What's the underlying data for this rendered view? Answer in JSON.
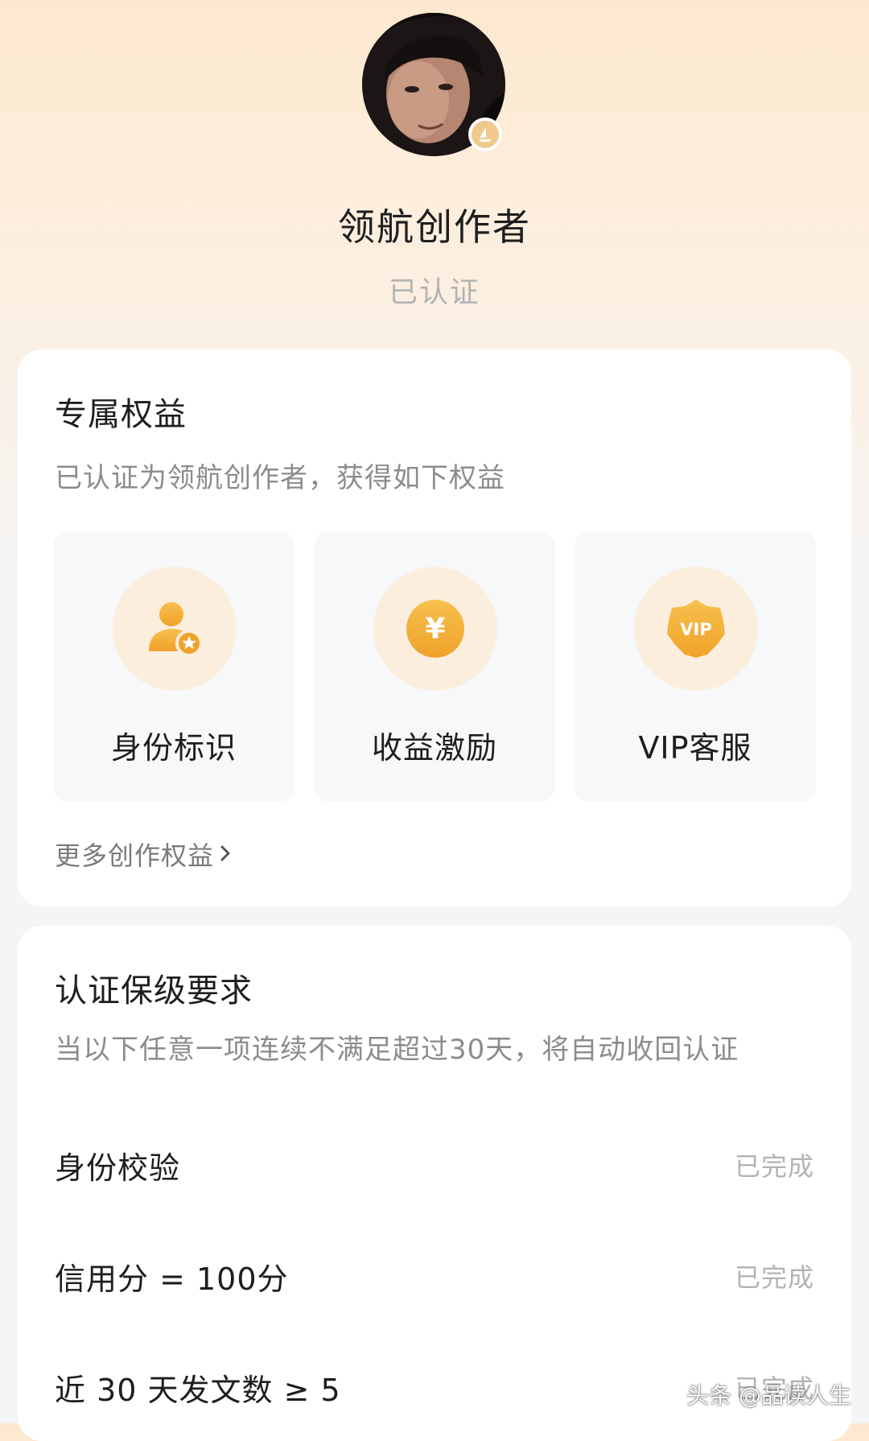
{
  "header": {
    "title": "领航创作者",
    "status": "已认证"
  },
  "benefits": {
    "title": "专属权益",
    "description": "已认证为领航创作者，获得如下权益",
    "items": [
      {
        "label": "身份标识",
        "icon": "user-star-icon"
      },
      {
        "label": "收益激励",
        "icon": "yuan-coin-icon",
        "glyph": "¥"
      },
      {
        "label": "VIP客服",
        "icon": "vip-badge-icon",
        "glyph": "VIP"
      }
    ],
    "more_label": "更多创作权益"
  },
  "requirements": {
    "title": "认证保级要求",
    "description": "当以下任意一项连续不满足超过30天，将自动收回认证",
    "items": [
      {
        "label": "身份校验",
        "status": "已完成"
      },
      {
        "label": "信用分 = 100分",
        "status": "已完成"
      },
      {
        "label": "近 30 天发文数 ≥ 5",
        "status": "已完成"
      }
    ]
  },
  "watermark": "头条 @品读人生",
  "colors": {
    "accent": "#f2b23a",
    "icon_circle": "#fbeedd",
    "muted_text": "#b3b3b3"
  }
}
